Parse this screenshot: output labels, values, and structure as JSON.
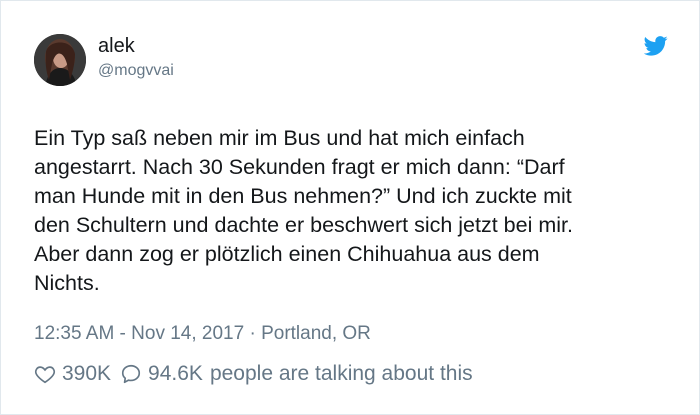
{
  "tweet": {
    "author_name": "alek",
    "author_handle": "@mogvvai",
    "text": "Ein Typ saß neben mir im Bus und hat mich einfach\nangestarrt. Nach 30 Sekunden fragt er mich dann: “Darf\nman Hunde mit in den Bus nehmen?” Und ich zuckte mit\nden Schultern und dachte er beschwert sich jetzt bei mir.\nAber dann zog er plötzlich einen Chihuahua aus dem\nNichts.",
    "timestamp": "12:35 AM - Nov 14, 2017",
    "separator": "·",
    "location": "Portland, OR",
    "likes": "390K",
    "talking_count": "94.6K",
    "talking_label": "people are talking about this"
  },
  "icons": {
    "logo": "twitter-bird-icon",
    "like": "heart-icon",
    "reply": "speech-bubble-icon"
  },
  "colors": {
    "brand": "#1da1f2",
    "text": "#14171a",
    "muted": "#657786",
    "border": "#e1e8ed"
  }
}
